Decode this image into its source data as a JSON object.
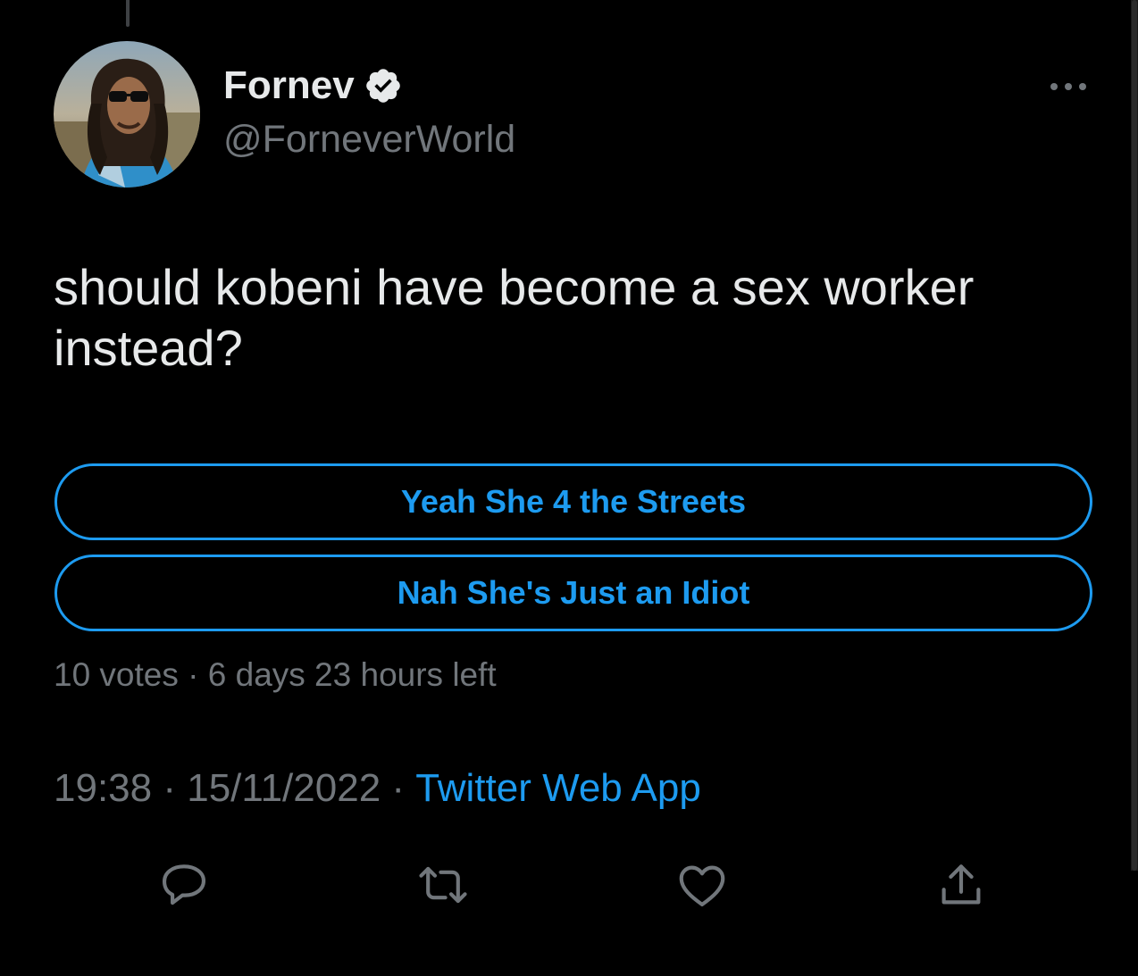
{
  "author": {
    "display_name": "Fornev",
    "handle": "@ForneverWorld",
    "verified": true,
    "avatar_icon": "avatar-photo"
  },
  "tweet": {
    "text": "should kobeni have become a sex worker instead?"
  },
  "poll": {
    "options": [
      {
        "label": "Yeah She 4 the Streets"
      },
      {
        "label": "Nah She's Just an Idiot"
      }
    ],
    "votes": "10 votes",
    "separator": " · ",
    "time_left": "6 days 23 hours left"
  },
  "meta": {
    "time": "19:38",
    "date": "15/11/2022",
    "separator": " · ",
    "source": "Twitter Web App"
  },
  "actions": [
    {
      "name": "reply",
      "icon": "reply-icon"
    },
    {
      "name": "retweet",
      "icon": "retweet-icon"
    },
    {
      "name": "like",
      "icon": "heart-icon"
    },
    {
      "name": "share",
      "icon": "share-icon"
    }
  ],
  "colors": {
    "background": "#000000",
    "accent": "#1d9bf0",
    "primary_text": "#e7e9ea",
    "secondary_text": "#71767b"
  }
}
